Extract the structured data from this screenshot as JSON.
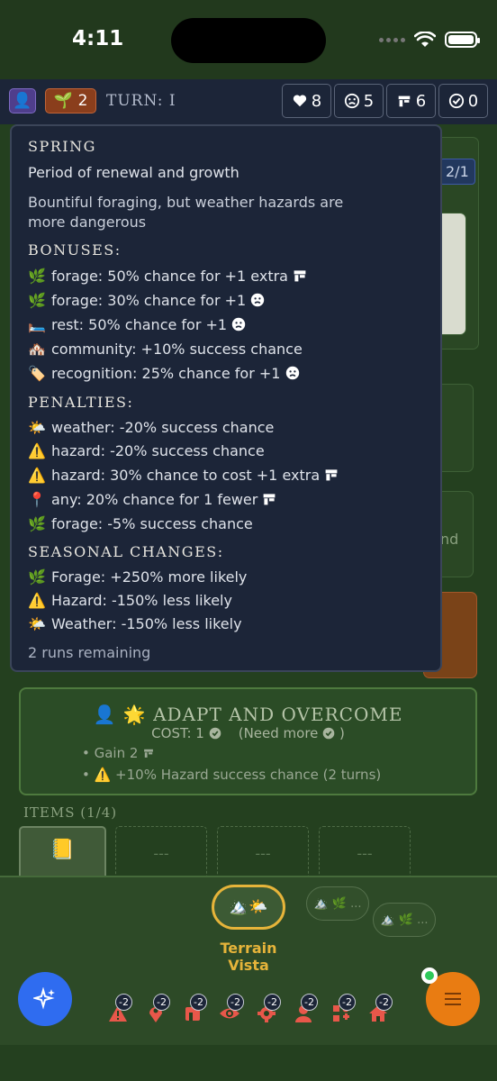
{
  "status_bar": {
    "time": "4:11"
  },
  "top_bar": {
    "avatar_icon": "👤",
    "season": {
      "icon": "🌱",
      "value": "2"
    },
    "turn_label": "TURN:",
    "turn_value": "I",
    "stats": [
      {
        "icon": "heart-icon",
        "value": "8"
      },
      {
        "icon": "frown-icon",
        "value": "5"
      },
      {
        "icon": "shelter-icon",
        "value": "6"
      },
      {
        "icon": "check-badge-icon",
        "value": "0"
      }
    ]
  },
  "background": {
    "partial_label_1": "2/1",
    "partial_label_2": "nd"
  },
  "tooltip": {
    "title": "SPRING",
    "subtitle": "Period of renewal and growth",
    "description_1": "Bountiful foraging, but weather hazards are",
    "description_2": "more dangerous",
    "bonuses_heading": "BONUSES:",
    "bonuses": [
      {
        "emoji": "🌿",
        "text": "forage: 50% chance for +1 extra"
      },
      {
        "emoji": "🌿",
        "text": "forage: 30% chance for +1"
      },
      {
        "emoji": "🛏️",
        "text": "rest: 50% chance for +1"
      },
      {
        "emoji": "🏘️",
        "text": "community: +10% success chance"
      },
      {
        "emoji": "🏷️",
        "text": "recognition: 25% chance for +1"
      }
    ],
    "penalties_heading": "PENALTIES:",
    "penalties": [
      {
        "emoji": "🌤️",
        "text": "weather: -20% success chance"
      },
      {
        "emoji": "⚠️",
        "text": "hazard: -20% success chance"
      },
      {
        "emoji": "⚠️",
        "text": "hazard: 30% chance to cost +1 extra"
      },
      {
        "emoji": "📍",
        "text": "any: 20% chance for 1 fewer"
      },
      {
        "emoji": "🌿",
        "text": "forage: -5% success chance"
      }
    ],
    "changes_heading": "SEASONAL CHANGES:",
    "changes": [
      {
        "emoji": "🌿",
        "text": "Forage: +250% more likely"
      },
      {
        "emoji": "⚠️",
        "text": "Hazard: -150% less likely"
      },
      {
        "emoji": "🌤️",
        "text": "Weather: -150% less likely"
      }
    ],
    "remaining": "2 runs remaining"
  },
  "adapt_card": {
    "icons": "👤 🌟",
    "title": "ADAPT AND OVERCOME",
    "cost_label": "COST: 1",
    "need_more": "(Need more",
    "need_more_close": ")",
    "effect_1": "• Gain 2",
    "effect_2": "• ⚠️ +10% Hazard success chance (2 turns)"
  },
  "items": {
    "label": "ITEMS (1/4)",
    "filled_icon": "📒",
    "empty_label": "---"
  },
  "terrain": {
    "pill_icons": "🏔️🌤️",
    "label_line1": "Terrain",
    "label_line2": "Vista",
    "ghost_1": "🏔️ 🌿 ...",
    "ghost_2": "🏔️ 🌿 ..."
  },
  "actions": [
    {
      "name": "hazard",
      "badge": "-2"
    },
    {
      "name": "location",
      "badge": "-2"
    },
    {
      "name": "shelter",
      "badge": "-2"
    },
    {
      "name": "scout",
      "badge": "-2"
    },
    {
      "name": "settings",
      "badge": "-2"
    },
    {
      "name": "person",
      "badge": "-2"
    },
    {
      "name": "tools",
      "badge": "-2"
    },
    {
      "name": "home",
      "badge": "-2"
    }
  ],
  "colors": {
    "accent_orange": "#e97c12",
    "accent_blue": "#2f6cf0",
    "danger_red": "#e8574a",
    "gold": "#e6b43a"
  }
}
